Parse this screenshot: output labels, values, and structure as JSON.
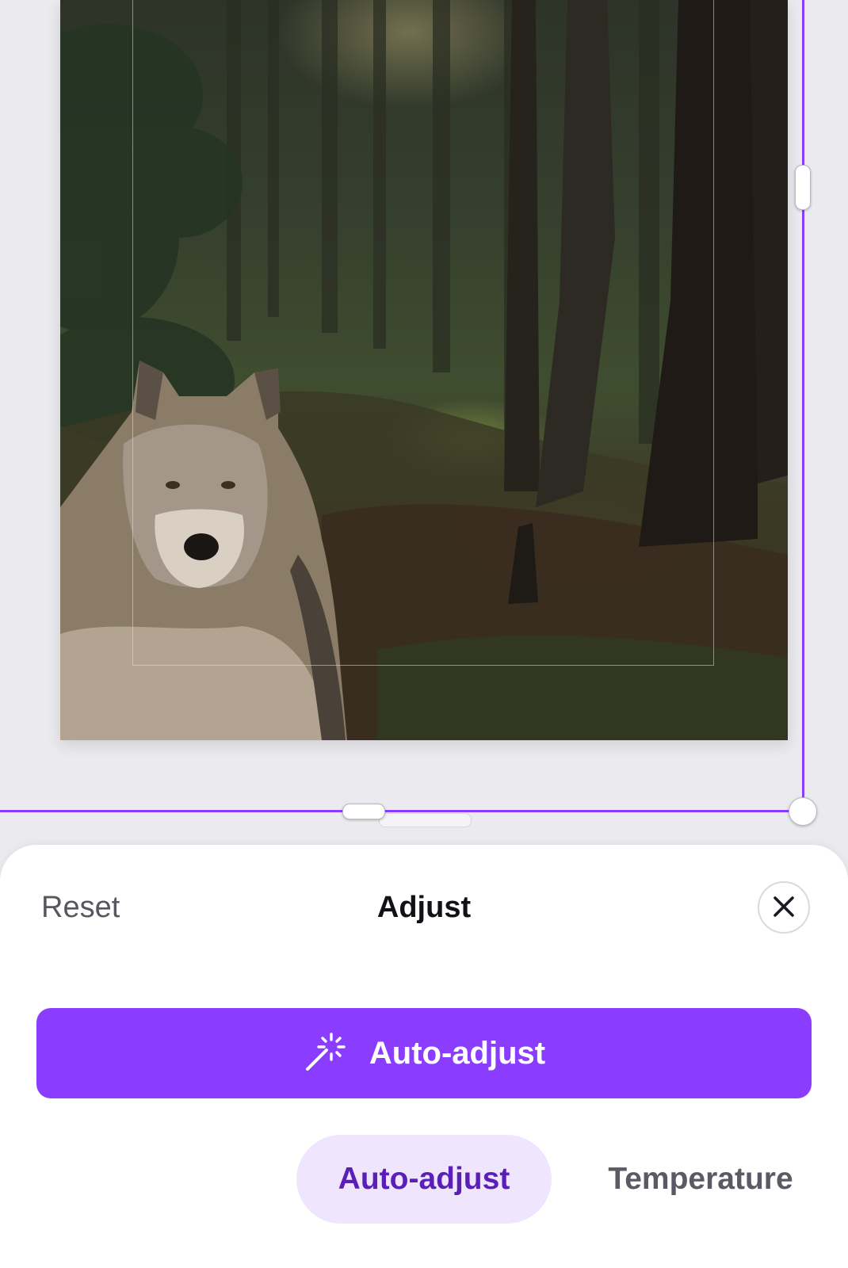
{
  "canvas": {
    "image_subject": "Wolf sitting in a forest",
    "accent_color": "#8b3dff"
  },
  "panel": {
    "reset_label": "Reset",
    "title": "Adjust",
    "close_icon": "close-icon",
    "auto_adjust_button": {
      "icon": "magic-wand-icon",
      "label": "Auto-adjust",
      "background": "#8b3dff"
    },
    "tabs": [
      {
        "label": "Auto-adjust",
        "active": true
      },
      {
        "label": "Temperature",
        "active": false
      }
    ]
  }
}
